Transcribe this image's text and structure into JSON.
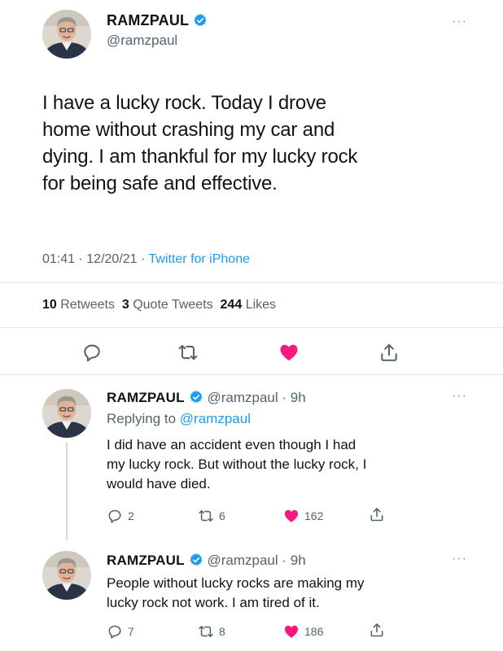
{
  "main_tweet": {
    "display_name": "RAMZPAUL",
    "handle": "@ramzpaul",
    "text_lines": [
      "I have a lucky rock. Today I drove",
      "home without crashing my car and",
      "dying. I am thankful for my lucky rock",
      "for being safe and effective."
    ],
    "time": "01:41",
    "date": "12/20/21",
    "sep1": "·",
    "sep2": "·",
    "source": "Twitter for iPhone",
    "retweets_count": "10",
    "retweets_label": "Retweets",
    "quotes_count": "3",
    "quotes_label": "Quote Tweets",
    "likes_count": "244",
    "likes_label": "Likes"
  },
  "replies": [
    {
      "display_name": "RAMZPAUL",
      "handle_time": "@ramzpaul · 9h",
      "replying_prefix": "Replying to",
      "replying_to": "@ramzpaul",
      "text_lines": [
        "I did have an accident even though I had",
        "my lucky rock. But without the lucky rock, I",
        "would have died."
      ],
      "replies": "2",
      "retweets": "6",
      "likes": "162"
    },
    {
      "display_name": "RAMZPAUL",
      "handle_time": "@ramzpaul · 9h",
      "text_lines": [
        "People without lucky rocks are making my",
        "lucky rock not work. I am tired of it."
      ],
      "replies": "7",
      "retweets": "8",
      "likes": "186"
    }
  ],
  "more_glyph": "···",
  "colors": {
    "accent": "#1d9bf0",
    "like": "#f91880",
    "text": "#0f1419",
    "muted": "#536471"
  },
  "icons": [
    "verified-badge-icon",
    "reply-icon",
    "retweet-icon",
    "heart-icon",
    "share-icon",
    "more-icon"
  ]
}
